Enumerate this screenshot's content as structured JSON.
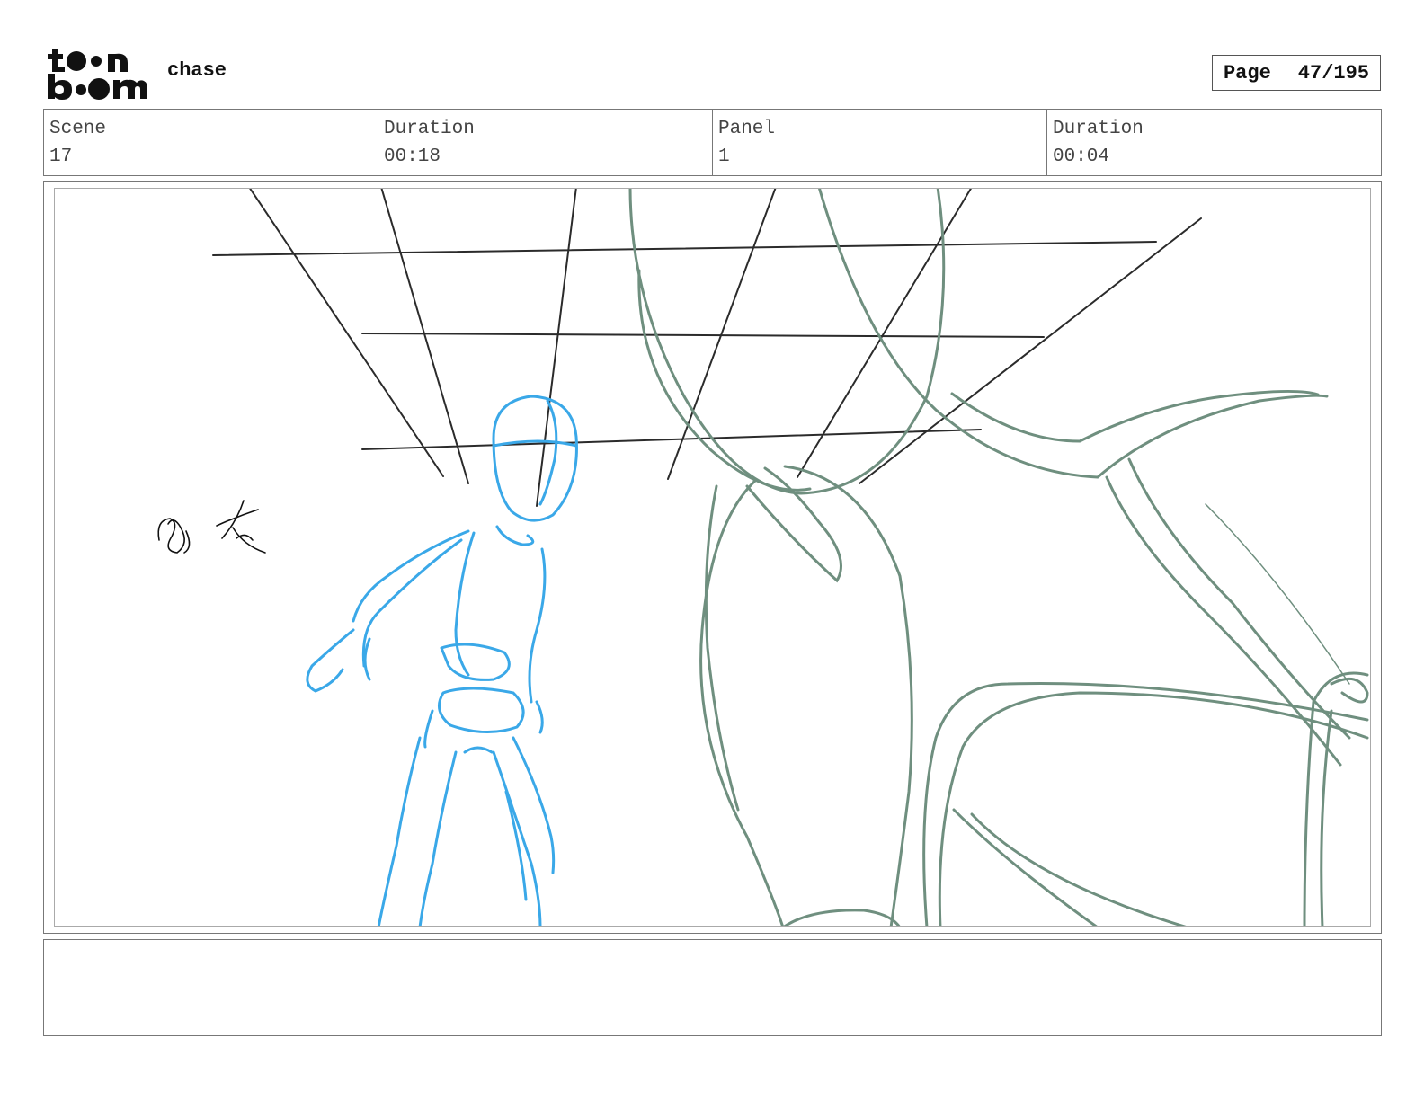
{
  "header": {
    "logo_text": "toon boom",
    "project_title": "chase",
    "page_label": "Page",
    "page_number": "47/195"
  },
  "info": {
    "scene_label": "Scene",
    "scene_value": "17",
    "scene_duration_label": "Duration",
    "scene_duration_value": "00:18",
    "panel_label": "Panel",
    "panel_value": "1",
    "panel_duration_label": "Duration",
    "panel_duration_value": "00:04"
  },
  "colors": {
    "character_sketch": "#3aa8e8",
    "creature_sketch": "#6f8f7f",
    "perspective_lines": "#2b2b2b"
  },
  "notes": {
    "text": ""
  }
}
